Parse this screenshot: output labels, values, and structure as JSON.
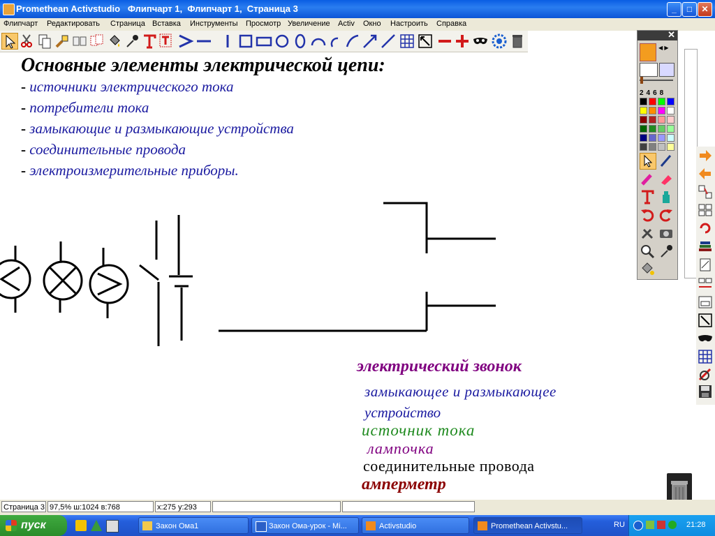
{
  "window": {
    "title": "Promethean Activstudio   Флипчарт 1,  Флипчарт 1,  Страница 3",
    "btn_min": "_",
    "btn_max": "□",
    "btn_close": "✕"
  },
  "menu": [
    "Флипчарт",
    "Редактировать",
    "Страница",
    "Вставка",
    "Инструменты",
    "Просмотр",
    "Увеличение",
    "Activ",
    "Окно",
    "Настроить",
    "Справка"
  ],
  "content": {
    "heading": "Основные элементы электрической цепи:",
    "bullets": [
      "источники электрического тока",
      "потребители тока",
      "замыкающие и размыкающие устройства",
      "соединительные провода",
      "электроизмерительные приборы."
    ],
    "bullet_mark": "- ",
    "labels": {
      "bell": "электрический звонок",
      "switch_line1": "замыкающее и размыкающее",
      "switch_line2": "устройство",
      "source": "источник тока",
      "lamp": "лампочка",
      "wires": "соединительные провода",
      "ammeter": "амперметр"
    }
  },
  "colors": {
    "bullet_text": "#1a1aa0",
    "bell": "#800080",
    "switch": "#1a1aa0",
    "source": "#1f8a1f",
    "lamp": "#800080",
    "wires": "#000000",
    "ammeter": "#8b0000"
  },
  "tool_panel": {
    "close": "✕",
    "pen_widths": "2468"
  },
  "status": {
    "page": "Страница 3",
    "zoom": "97,5%  ш:1024  в:768",
    "coords": "x:275  y:293"
  },
  "taskbar": {
    "start": "пуск",
    "buttons": [
      "Закон Ома1",
      "Закон Ома-урок - Mi...",
      "Activstudio",
      "Promethean Activstu..."
    ],
    "lang": "RU",
    "time": "21:28"
  }
}
